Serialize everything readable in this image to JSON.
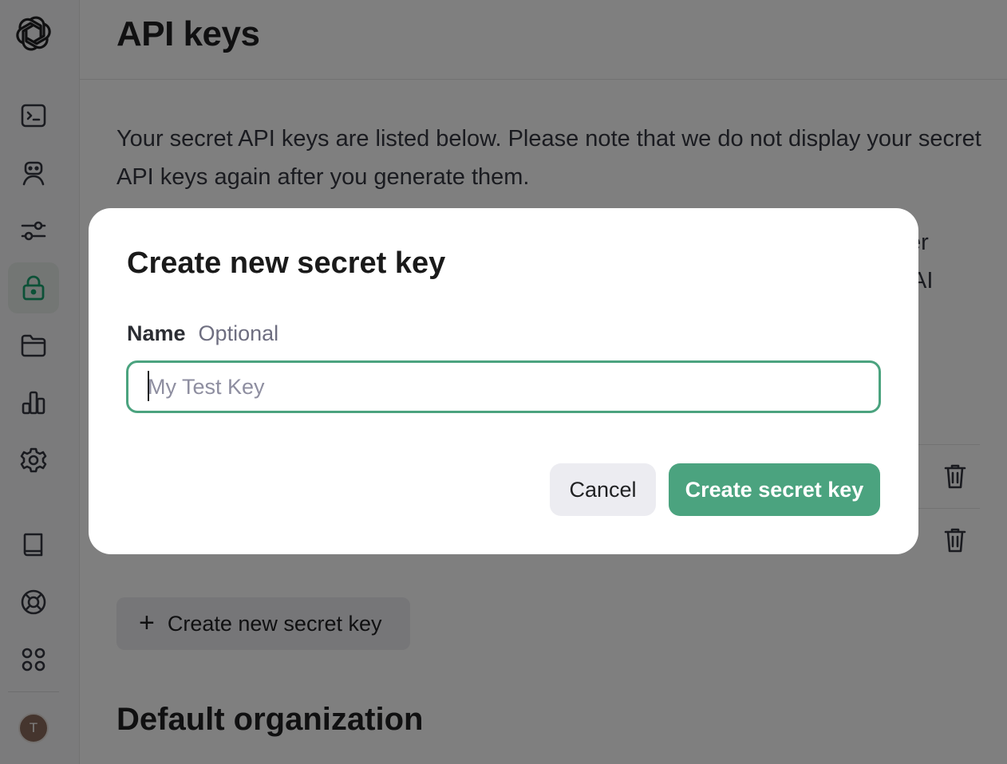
{
  "page": {
    "title": "API keys",
    "intro_text": "Your secret API keys are listed below. Please note that we do not display your secret API keys again after you generate them.",
    "partial_text_1": "er",
    "partial_text_2": "AI",
    "create_button_label": "Create new secret key",
    "section_title": "Default organization"
  },
  "sidebar": {
    "items": [
      {
        "name": "terminal-icon"
      },
      {
        "name": "assistant-icon"
      },
      {
        "name": "sliders-icon"
      },
      {
        "name": "lock-icon",
        "active": true
      },
      {
        "name": "folder-icon"
      },
      {
        "name": "chart-icon"
      },
      {
        "name": "gear-icon"
      },
      {
        "name": "book-icon"
      },
      {
        "name": "help-icon"
      },
      {
        "name": "apps-icon"
      }
    ],
    "avatar_initial": "T"
  },
  "modal": {
    "title": "Create new secret key",
    "field_label": "Name",
    "field_hint": "Optional",
    "input_placeholder": "My Test Key",
    "input_value": "",
    "cancel_label": "Cancel",
    "submit_label": "Create secret key"
  },
  "colors": {
    "accent": "#4ba37f",
    "overlay": "rgba(0,0,0,0.5)"
  }
}
